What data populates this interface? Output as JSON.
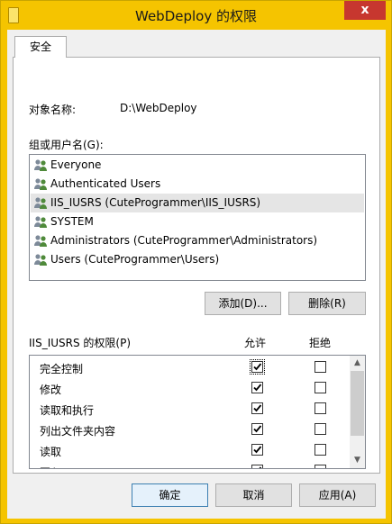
{
  "window": {
    "title": "WebDeploy 的权限",
    "close_glyph": "x"
  },
  "tabs": [
    {
      "label": "安全"
    }
  ],
  "object": {
    "label": "对象名称:",
    "value": "D:\\WebDeploy"
  },
  "groups": {
    "label": "组或用户名(G):",
    "items": [
      {
        "label": "Everyone",
        "icon": "users-icon"
      },
      {
        "label": "Authenticated Users",
        "icon": "users-icon"
      },
      {
        "label": "IIS_IUSRS (CuteProgrammer\\IIS_IUSRS)",
        "icon": "users-icon",
        "selected": true
      },
      {
        "label": "SYSTEM",
        "icon": "users-icon"
      },
      {
        "label": "Administrators (CuteProgrammer\\Administrators)",
        "icon": "users-icon"
      },
      {
        "label": "Users (CuteProgrammer\\Users)",
        "icon": "users-icon"
      }
    ]
  },
  "buttons": {
    "add": "添加(D)...",
    "remove": "删除(R)"
  },
  "permissions": {
    "label": "IIS_IUSRS 的权限(P)",
    "allow_header": "允许",
    "deny_header": "拒绝",
    "rows": [
      {
        "name": "完全控制",
        "allow": true,
        "deny": false
      },
      {
        "name": "修改",
        "allow": true,
        "deny": false
      },
      {
        "name": "读取和执行",
        "allow": true,
        "deny": false
      },
      {
        "name": "列出文件夹内容",
        "allow": true,
        "deny": false
      },
      {
        "name": "读取",
        "allow": true,
        "deny": false
      },
      {
        "name": "写入",
        "allow": true,
        "deny": false
      }
    ]
  },
  "footer": {
    "ok": "确定",
    "cancel": "取消",
    "apply": "应用(A)"
  }
}
